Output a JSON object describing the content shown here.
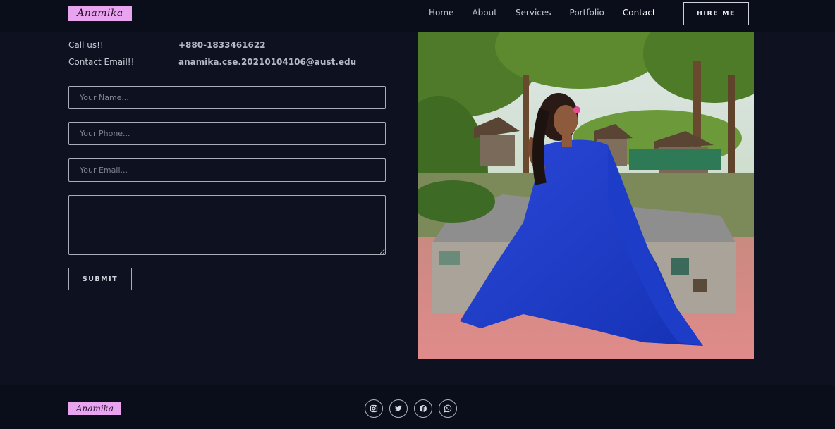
{
  "nav": {
    "logo": "Anamika",
    "links": [
      {
        "label": "Home"
      },
      {
        "label": "About"
      },
      {
        "label": "Services"
      },
      {
        "label": "Portfolio"
      },
      {
        "label": "Contact",
        "active": true
      }
    ],
    "hire_label": "HIRE ME"
  },
  "contact": {
    "call_label": "Call us!!",
    "call_value": "+880-1833461622",
    "email_label": "Contact Email!!",
    "email_value": "anamika.cse.20210104106@aust.edu"
  },
  "form": {
    "name_placeholder": "Your Name...",
    "phone_placeholder": "Your Phone...",
    "email_placeholder": "Your Email...",
    "message_placeholder": "",
    "submit_label": "SUBMIT"
  },
  "footer": {
    "logo": "Anamika",
    "socials": [
      "instagram-icon",
      "twitter-icon",
      "facebook-icon",
      "whatsapp-icon"
    ]
  },
  "colors": {
    "background": "#0d1120",
    "nav_background": "#0a0e1a",
    "logo_background": "#e9a4ef",
    "active_underline": "#e0557c"
  }
}
